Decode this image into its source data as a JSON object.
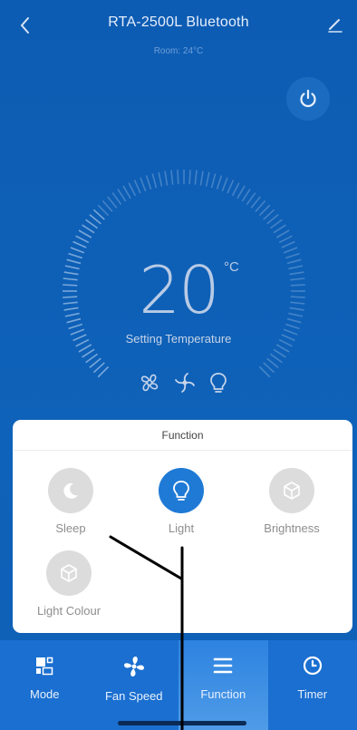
{
  "header": {
    "title": "RTA-2500L Bluetooth",
    "subtitle": "Room: 24°C",
    "back_icon": "chevron-left-icon",
    "edit_icon": "pencil-icon",
    "power_icon": "power-icon"
  },
  "dial": {
    "temperature": "20",
    "unit": "°C",
    "label": "Setting Temperature",
    "status_icons": [
      "fan-icon",
      "pinwheel-icon",
      "bulb-icon"
    ]
  },
  "function_panel": {
    "title": "Function",
    "items": [
      {
        "label": "Sleep",
        "icon": "moon-icon",
        "active": false
      },
      {
        "label": "Light",
        "icon": "bulb-icon",
        "active": true
      },
      {
        "label": "Brightness",
        "icon": "cube-icon",
        "active": false
      },
      {
        "label": "Light Colour",
        "icon": "cube-icon",
        "active": false
      }
    ]
  },
  "nav": {
    "items": [
      {
        "label": "Mode",
        "icon": "mode-icon"
      },
      {
        "label": "Fan Speed",
        "icon": "fan-icon"
      },
      {
        "label": "Function",
        "icon": "menu-icon",
        "active": true
      },
      {
        "label": "Timer",
        "icon": "clock-icon"
      }
    ]
  },
  "colors": {
    "background": "#0f5fb6",
    "accent": "#1f7ad6",
    "nav": "#1a6fd0",
    "inactive_circle": "#dcdcdc"
  }
}
